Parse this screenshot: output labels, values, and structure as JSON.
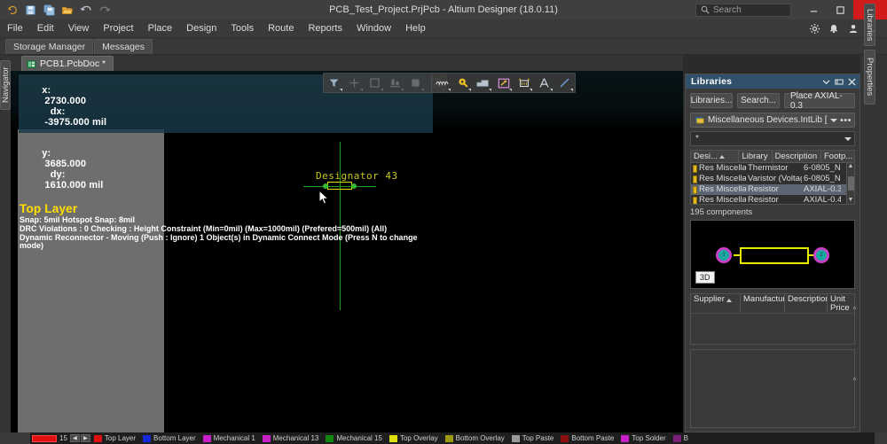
{
  "titlebar": {
    "title": "PCB_Test_Project.PrjPcb - Altium Designer (18.0.11)",
    "quick_access": [
      {
        "name": "undo-history-icon",
        "label": "↺"
      },
      {
        "name": "save-icon",
        "label": "Save"
      },
      {
        "name": "save-all-icon",
        "label": "Save All"
      },
      {
        "name": "open-folder-icon",
        "label": "Open"
      },
      {
        "name": "undo-icon",
        "label": "Undo"
      },
      {
        "name": "redo-icon",
        "label": "Redo"
      }
    ],
    "search_placeholder": "Search",
    "minimize_label": "–",
    "maximize_label": "☐",
    "close_label": "✕"
  },
  "menubar": {
    "items": [
      {
        "label": "File",
        "name": "menu-file"
      },
      {
        "label": "Edit",
        "name": "menu-edit"
      },
      {
        "label": "View",
        "name": "menu-view"
      },
      {
        "label": "Project",
        "name": "menu-project"
      },
      {
        "label": "Place",
        "name": "menu-place"
      },
      {
        "label": "Design",
        "name": "menu-design"
      },
      {
        "label": "Tools",
        "name": "menu-tools"
      },
      {
        "label": "Route",
        "name": "menu-route"
      },
      {
        "label": "Reports",
        "name": "menu-reports"
      },
      {
        "label": "Window",
        "name": "menu-window"
      },
      {
        "label": "Help",
        "name": "menu-help"
      }
    ],
    "right_icons": [
      "gear-icon",
      "bell-icon",
      "user-icon",
      "chevron-down-icon"
    ]
  },
  "panel_tabs": [
    {
      "label": "Storage Manager",
      "name": "tab-storage-manager"
    },
    {
      "label": "Messages",
      "name": "tab-messages"
    }
  ],
  "left_rail": {
    "navigator_label": "Navigator"
  },
  "document_tab": {
    "label": "PCB1.PcbDoc *"
  },
  "canvas": {
    "status": {
      "x_label": "x:",
      "x_value": "2730.000",
      "dx_label": "dx:",
      "dx_value": "-3975.000 mil",
      "y_label": "y:",
      "y_value": "3685.000",
      "dy_label": "dy:",
      "dy_value": "1610.000 mil",
      "layer": "Top Layer",
      "snap": "Snap: 5mil Hotspot Snap: 8mil",
      "drc": "DRC Violations : 0 Checking : Height Constraint (Min=0mil) (Max=1000mil) (Prefered=500mil) (All)",
      "dynamic": "Dynamic Reconnector - Moving (Push : Ignore) 1 Object(s) in Dynamic Connect Mode (Press N to change mode)"
    },
    "toolbar_left": [
      {
        "name": "filter-icon",
        "disabled": false
      },
      {
        "name": "add-crosshair-icon",
        "disabled": true
      },
      {
        "name": "square-select-icon",
        "disabled": true
      },
      {
        "name": "align-bottom-icon",
        "disabled": true
      },
      {
        "name": "fill-region-icon",
        "disabled": true
      },
      {
        "name": "edit-polygon-icon",
        "disabled": true
      }
    ],
    "toolbar_right": [
      {
        "name": "route-net-icon",
        "disabled": false
      },
      {
        "name": "place-via-icon",
        "disabled": false
      },
      {
        "name": "place-polygon-icon",
        "disabled": false
      },
      {
        "name": "place-dimension-icon",
        "disabled": false
      },
      {
        "name": "place-component-icon",
        "disabled": false
      },
      {
        "name": "place-text-icon",
        "disabled": false
      },
      {
        "name": "place-line-icon",
        "disabled": false
      }
    ],
    "component": {
      "designator": "Designator 43"
    }
  },
  "libraries_panel": {
    "title": "Libraries",
    "header_buttons": [
      "chevron-down-icon",
      "pin-icon",
      "close-icon"
    ],
    "buttons": [
      {
        "label": "Libraries...",
        "name": "libraries-button"
      },
      {
        "label": "Search...",
        "name": "search-button"
      },
      {
        "label": "Place AXIAL-0.3",
        "name": "place-component-button"
      }
    ],
    "library_select": {
      "value": "Miscellaneous Devices.IntLib [Compo"
    },
    "filter": {
      "value": "*"
    },
    "components_table": {
      "columns": [
        "Desi...",
        "Library",
        "Description",
        "Footp..."
      ],
      "rows": [
        {
          "designator": "Res Miscella",
          "library": "",
          "description": "Thermistor",
          "footprint": "6-0805_N",
          "selected": false
        },
        {
          "designator": "Res Miscella",
          "library": "",
          "description": "Varistor (Voltage-",
          "footprint": "6-0805_N",
          "selected": false
        },
        {
          "designator": "Res Miscella",
          "library": "",
          "description": "Resistor",
          "footprint": "AXIAL-0.3",
          "selected": true
        },
        {
          "designator": "Res Miscella",
          "library": "",
          "description": "Resistor",
          "footprint": "AXIAL-0.4",
          "selected": false
        }
      ]
    },
    "component_count": "195 components",
    "preview": {
      "badge_3d": "3D",
      "pad1": "1",
      "pad2": "2"
    },
    "supplier_table": {
      "columns": [
        "Supplier",
        "Manufacturer",
        "Description",
        "Unit Price"
      ],
      "rows": []
    }
  },
  "right_rail": {
    "tabs": [
      {
        "label": "Libraries",
        "name": "rail-tab-libraries"
      },
      {
        "label": "Properties",
        "name": "rail-tab-properties"
      }
    ]
  },
  "layer_bar": {
    "active_index_label": "15",
    "prev_label": "◀",
    "next_label": "▶",
    "layers": [
      {
        "name": "Top Layer",
        "color": "#e01010"
      },
      {
        "name": "Bottom Layer",
        "color": "#1428dc"
      },
      {
        "name": "Mechanical 1",
        "color": "#c820c8"
      },
      {
        "name": "Mechanical 13",
        "color": "#c820c8"
      },
      {
        "name": "Mechanical 15",
        "color": "#108810"
      },
      {
        "name": "Top Overlay",
        "color": "#e0e010"
      },
      {
        "name": "Bottom Overlay",
        "color": "#9a9a10"
      },
      {
        "name": "Top Paste",
        "color": "#9a9a9a"
      },
      {
        "name": "Bottom Paste",
        "color": "#8c1010"
      },
      {
        "name": "Top Solder",
        "color": "#c820c8"
      },
      {
        "name": "B",
        "color": "#7a2078"
      }
    ]
  },
  "colors": {
    "accent_panel_header": "#31506b",
    "window_close": "#d11b1b",
    "canvas_bg": "#000000",
    "status_layer": "#ffe000",
    "designator": "#c8c81e",
    "pad_green": "#36b836",
    "body_yellow": "#e0e000"
  }
}
